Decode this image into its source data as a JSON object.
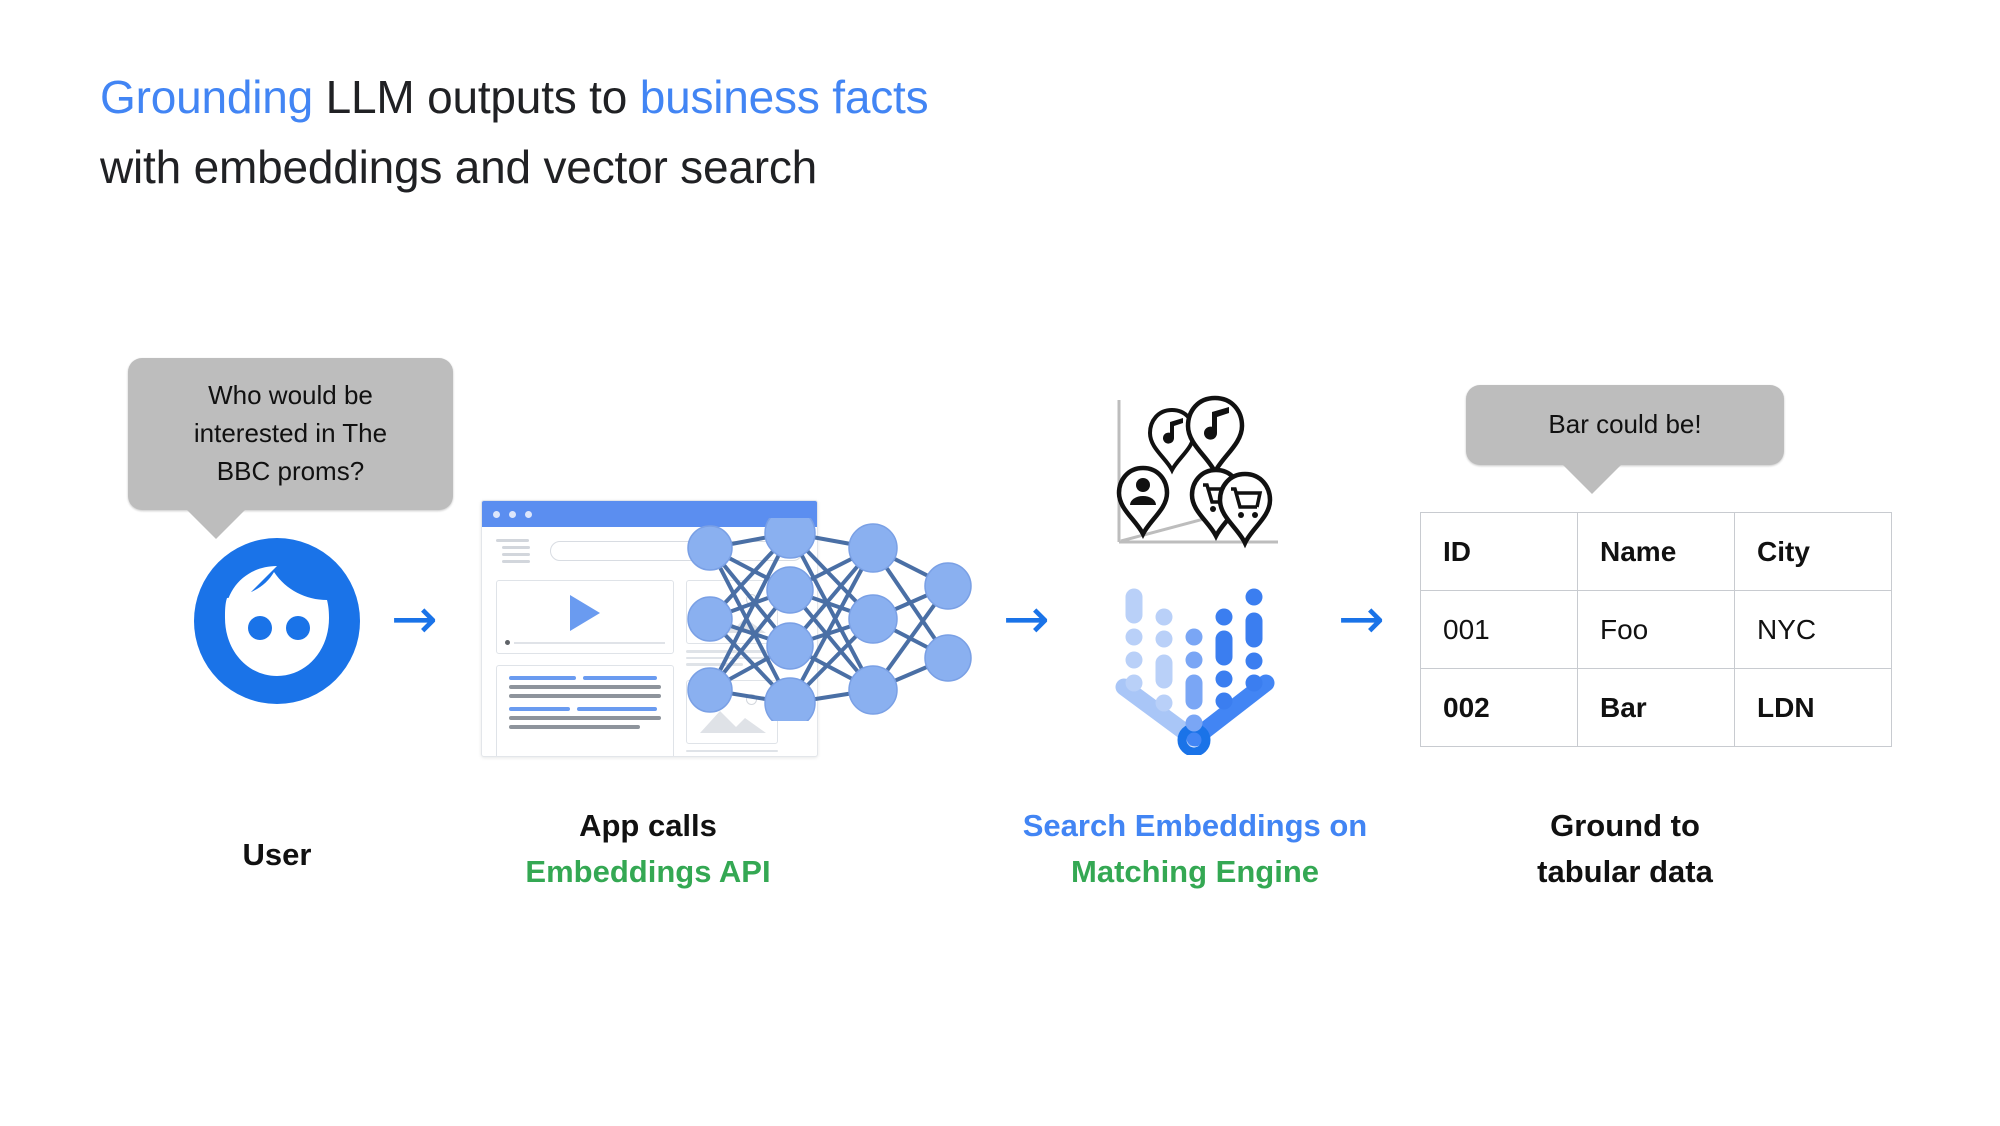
{
  "title": {
    "line1_part1": "Grounding",
    "line1_part2": " LLM outputs to ",
    "line1_part3": "business facts",
    "line2": "with embeddings and vector search"
  },
  "colors": {
    "accent_blue": "#4285f4",
    "link_blue": "#1a73e8",
    "green": "#34a853",
    "node_blue": "#8ab0f0",
    "edge_blue": "#4a6fa5",
    "bubble_gray": "#bdbdbd",
    "browser_bar": "#5b8ef0"
  },
  "bubbles": {
    "user_question": "Who would be\ninterested in The\nBBC proms?",
    "result_answer": "Bar could be!"
  },
  "stages": [
    {
      "id": "user",
      "icon": "user-avatar-icon",
      "caption_line1": "User",
      "caption_line1_color": "dark",
      "caption_line2": "",
      "caption_line2_color": "dark"
    },
    {
      "id": "app",
      "icon": "browser-window-icon",
      "caption_line1": "App calls",
      "caption_line1_color": "dark",
      "caption_line2": "Embeddings API",
      "caption_line2_color": "green"
    },
    {
      "id": "search",
      "icon": "vector-search-icon",
      "caption_line1": "Search Embeddings on",
      "caption_line1_color": "blue",
      "caption_line2": "Matching Engine",
      "caption_line2_color": "green"
    },
    {
      "id": "ground",
      "icon": "data-table-icon",
      "caption_line1": "Ground to",
      "caption_line1_color": "dark",
      "caption_line2": "tabular data",
      "caption_line2_color": "dark"
    }
  ],
  "arrows": {
    "glyph": "→",
    "count": 3
  },
  "browser": {
    "dot_count": 3,
    "search_placeholder": ""
  },
  "scatter_icon": {
    "pin_labels": [
      "music-note-pin",
      "music-note-pin",
      "person-pin",
      "shopping-cart-pin",
      "shopping-cart-pin"
    ]
  },
  "table": {
    "headers": [
      "ID",
      "Name",
      "City"
    ],
    "rows": [
      {
        "cells": [
          "001",
          "Foo",
          "NYC"
        ],
        "emphasis": "plain"
      },
      {
        "cells": [
          "002",
          "Bar",
          "LDN"
        ],
        "emphasis": "bold"
      }
    ]
  }
}
